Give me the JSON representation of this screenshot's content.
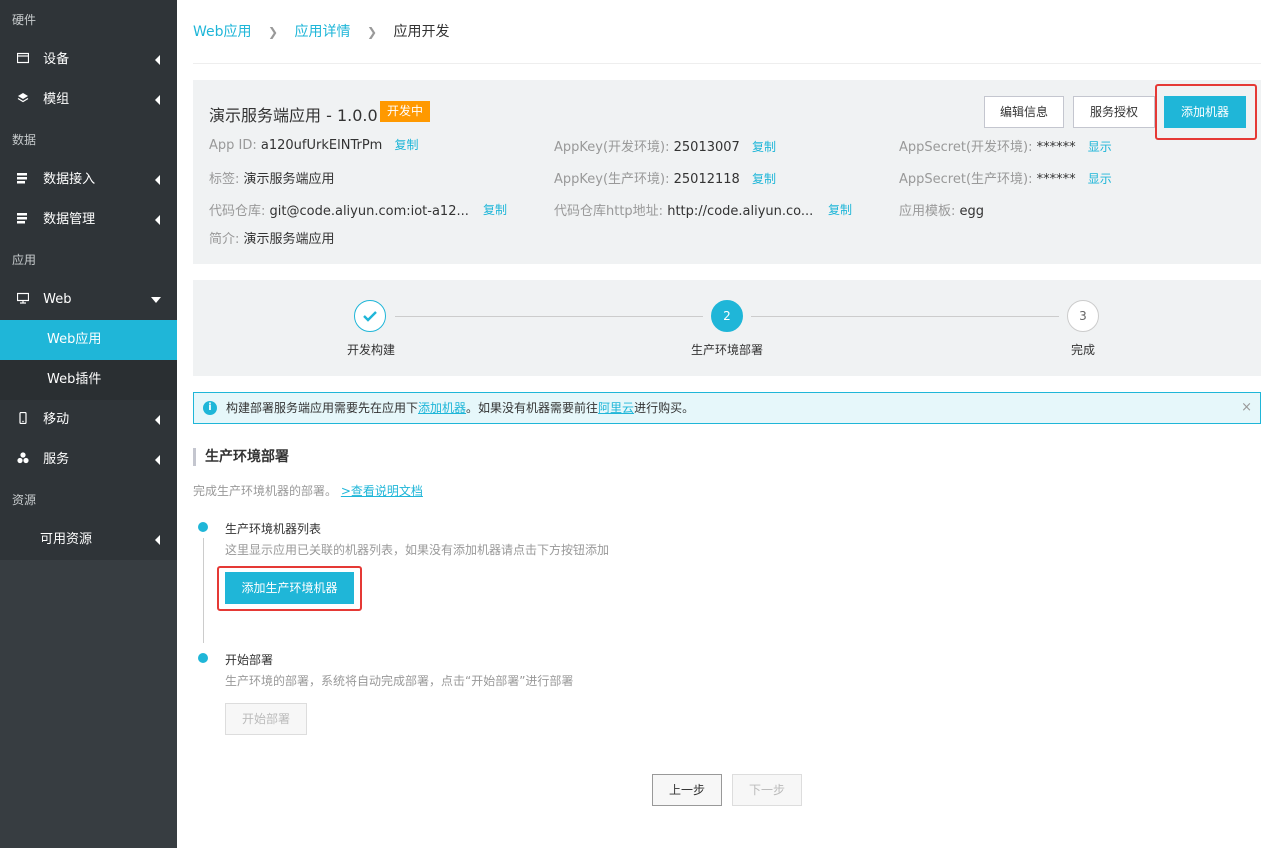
{
  "sidebar": {
    "sections": {
      "hardware": "硬件",
      "data": "数据",
      "app": "应用",
      "resource": "资源"
    },
    "items": {
      "device": "设备",
      "module": "模组",
      "data_access": "数据接入",
      "data_mgmt": "数据管理",
      "web": "Web",
      "web_app": "Web应用",
      "web_plugin": "Web插件",
      "mobile": "移动",
      "service": "服务",
      "available_resources": "可用资源"
    }
  },
  "breadcrumb": {
    "items": [
      "Web应用",
      "应用详情"
    ],
    "current": "应用开发"
  },
  "app_info": {
    "title": "演示服务端应用 - 1.0.0",
    "status": "开发中",
    "buttons": {
      "edit": "编辑信息",
      "authorize": "服务授权",
      "add_machine": "添加机器"
    },
    "fields": {
      "app_id_label": "App ID:",
      "app_id": "a120ufUrkElNTrPm",
      "copy": "复制",
      "appkey_dev_label": "AppKey(开发环境):",
      "appkey_dev": "25013007",
      "appsecret_dev_label": "AppSecret(开发环境):",
      "masked": "******",
      "show": "显示",
      "tag_label": "标签:",
      "tag": "演示服务端应用",
      "appkey_prod_label": "AppKey(生产环境):",
      "appkey_prod": "25012118",
      "appsecret_prod_label": "AppSecret(生产环境):",
      "repo_label": "代码仓库:",
      "repo": "git@code.aliyun.com:iot-a12...",
      "repo_http_label": "代码仓库http地址:",
      "repo_http": "http://code.aliyun.co...",
      "template_label": "应用模板:",
      "template": "egg",
      "intro_label": "简介:",
      "intro": "演示服务端应用"
    }
  },
  "steps": [
    {
      "label": "开发构建",
      "state": "done",
      "number": ""
    },
    {
      "label": "生产环境部署",
      "state": "active",
      "number": "2"
    },
    {
      "label": "完成",
      "state": "pending",
      "number": "3"
    }
  ],
  "alert": {
    "text_before": "构建部署服务端应用需要先在应用下",
    "link1": "添加机器",
    "text_middle": "。如果没有机器需要前往",
    "link2": "阿里云",
    "text_after": "进行购买。",
    "close": "×"
  },
  "section": {
    "title": "生产环境部署",
    "desc": "完成生产环境机器的部署。",
    "doc_link": ">查看说明文档"
  },
  "timeline": {
    "machines_title": "生产环境机器列表",
    "machines_desc": "这里显示应用已关联的机器列表，如果没有添加机器请点击下方按钮添加",
    "add_prod_machine": "添加生产环境机器",
    "deploy_title": "开始部署",
    "deploy_desc": "生产环境的部署，系统将自动完成部署，点击“开始部署”进行部署",
    "deploy_button": "开始部署"
  },
  "footer": {
    "prev": "上一步",
    "next": "下一步"
  },
  "colors": {
    "accent": "#1fb6d8",
    "status": "#ff9900",
    "highlight": "#e53935"
  }
}
